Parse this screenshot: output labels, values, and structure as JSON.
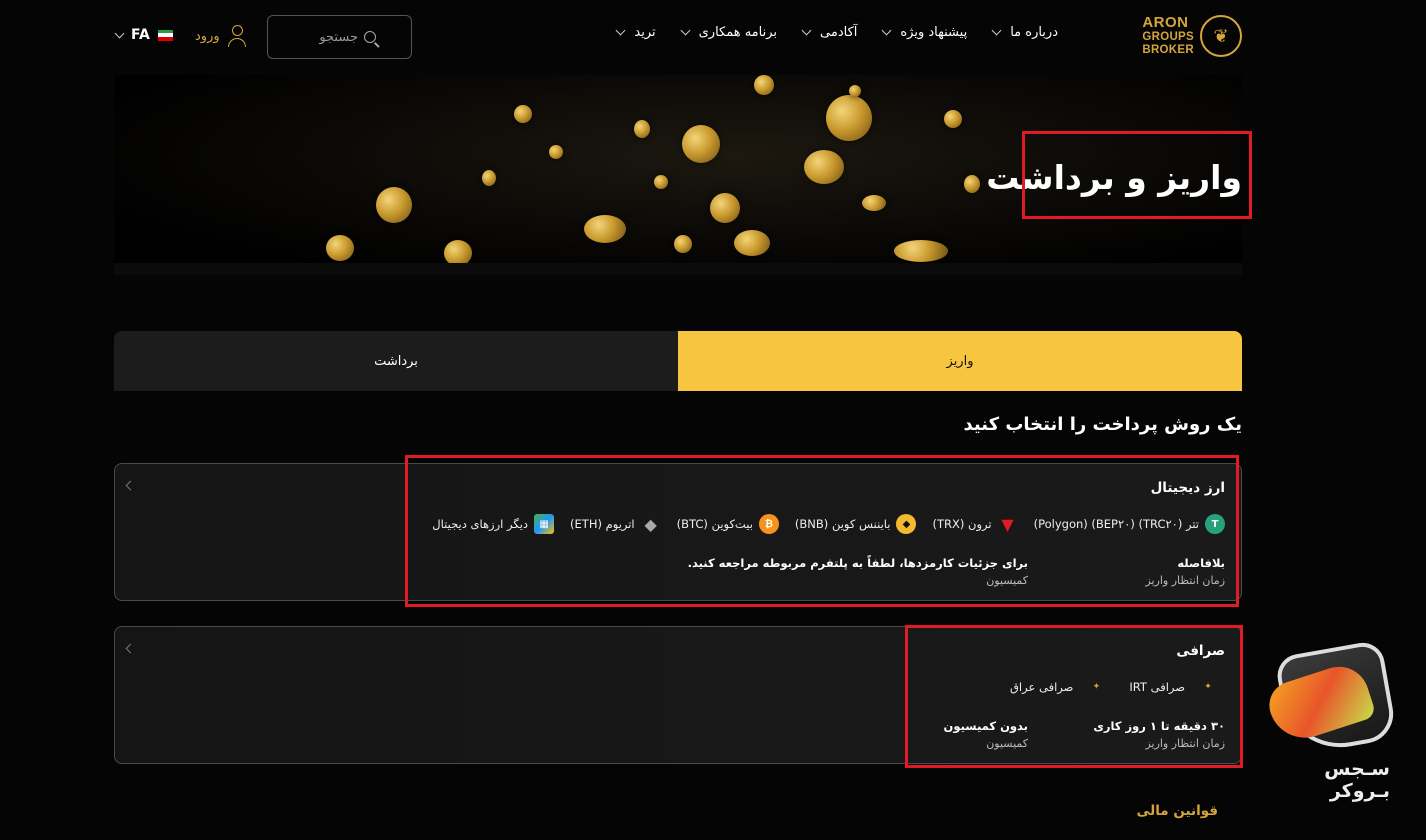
{
  "header": {
    "logo": {
      "line1": "ARON",
      "line2": "GROUPS",
      "line3": "BROKER"
    },
    "nav": [
      {
        "label": "ترید"
      },
      {
        "label": "برنامه همکاری"
      },
      {
        "label": "آکادمی"
      },
      {
        "label": "پیشنهاد ویژه"
      },
      {
        "label": "درباره ما"
      }
    ],
    "search_placeholder": "جستجو",
    "login_label": "ورود",
    "lang_label": "FA"
  },
  "hero": {
    "title": "واریز و برداشت"
  },
  "tabs": {
    "deposit": "واریز",
    "withdraw": "برداشت",
    "active": "deposit"
  },
  "section_title": "یک روش پرداخت را انتخاب کنید",
  "cards": [
    {
      "title": "ارز دیجیتال",
      "methods": [
        {
          "label": "تتر (TRC۲۰) (BEP۲۰) (Polygon)",
          "icon": "tether-icon"
        },
        {
          "label": "ترون (TRX)",
          "icon": "tron-icon"
        },
        {
          "label": "بایننس کوین (BNB)",
          "icon": "bnb-icon"
        },
        {
          "label": "بیت‌کوین (BTC)",
          "icon": "bitcoin-icon"
        },
        {
          "label": "اتریوم (ETH)",
          "icon": "ethereum-icon"
        },
        {
          "label": "دیگر ارزهای دیجیتال",
          "icon": "other-crypto-icon"
        }
      ],
      "wait_value": "بلافاصله",
      "wait_label": "زمان انتظار واریز",
      "fee_value": "برای جزئیات کارمزدها، لطفاً به پلتفرم مربوطه مراجعه کنید.",
      "fee_label": "کمیسیون"
    },
    {
      "title": "صرافی",
      "methods": [
        {
          "label": "صرافی IRT",
          "icon": "exchange-irt-icon"
        },
        {
          "label": "صرافی عراق",
          "icon": "exchange-iraq-icon"
        }
      ],
      "wait_value": "۳۰ دقیقه تا ۱ روز کاری",
      "wait_label": "زمان انتظار واریز",
      "fee_value": "بدون کمیسیون",
      "fee_label": "کمیسیون"
    }
  ],
  "rules_link": "قوانین مالی",
  "watermark": {
    "text": "سـجس بـروکر"
  },
  "colors": {
    "accent": "#f8c541",
    "gold": "#d4a53a",
    "highlight": "#e01b24"
  }
}
